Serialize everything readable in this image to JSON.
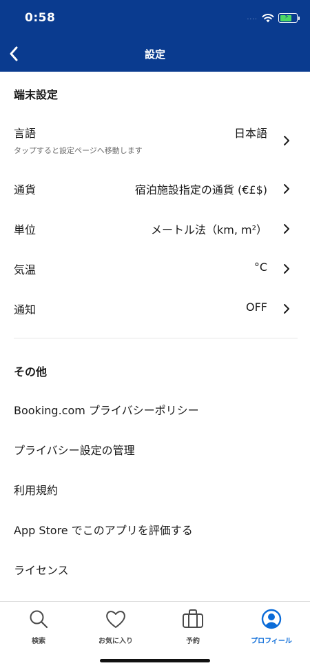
{
  "status_bar": {
    "time": "0:58",
    "signal": "....",
    "battery_percent": 70
  },
  "nav": {
    "title": "設定"
  },
  "device_section": {
    "title": "端末設定",
    "rows": [
      {
        "label": "言語",
        "value": "日本語",
        "subtext": "タップすると設定ページへ移動します"
      },
      {
        "label": "通貨",
        "value": "宿泊施設指定の通貨 (€£$)"
      },
      {
        "label": "単位",
        "value": "メートル法（km, m²）"
      },
      {
        "label": "気温",
        "value": "°C"
      },
      {
        "label": "通知",
        "value": "OFF"
      }
    ]
  },
  "other_section": {
    "title": "その他",
    "links": [
      "Booking.com プライバシーポリシー",
      "プライバシー設定の管理",
      "利用規約",
      "App Store でこのアプリを評価する",
      "ライセンス"
    ]
  },
  "tabbar": {
    "tabs": [
      {
        "label": "検索",
        "icon": "search-icon",
        "active": false
      },
      {
        "label": "お気に入り",
        "icon": "heart-icon",
        "active": false
      },
      {
        "label": "予約",
        "icon": "suitcase-icon",
        "active": false
      },
      {
        "label": "プロフィール",
        "icon": "profile-icon",
        "active": true
      }
    ]
  },
  "colors": {
    "header_bg": "#0a3b8f",
    "active_tab": "#0a6bd8",
    "text": "#1a1a1a",
    "subtext": "#6b6b6b"
  }
}
